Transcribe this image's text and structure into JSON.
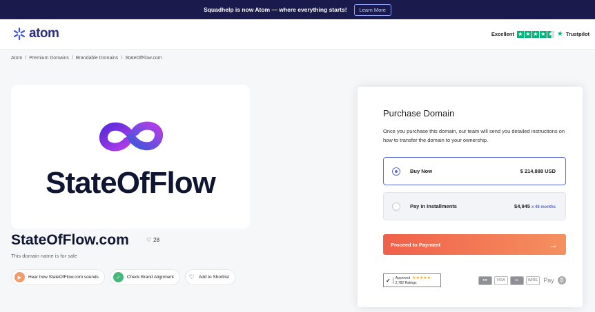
{
  "banner": {
    "text": "Squadhelp is now Atom — where everything starts!",
    "button": "Learn More"
  },
  "header": {
    "logo_text": "atom",
    "trustpilot": {
      "rating_word": "Excellent",
      "brand": "Trustpilot",
      "stars": 4.5
    }
  },
  "breadcrumb": [
    "Atom",
    "Premium Domains",
    "Brandable Domains",
    "StateOfFlow.com"
  ],
  "breadcrumb_separator": "/",
  "brand_logo": {
    "wordmark": "StateOfFlow"
  },
  "domain": {
    "name": "StateOfFlow.com",
    "likes": "28",
    "status": "This domain name is for sale"
  },
  "actions": [
    {
      "label": "Hear how StateOfFlow.com sounds",
      "icon": "play-icon"
    },
    {
      "label": "Check Brand Alignment",
      "icon": "check-icon"
    },
    {
      "label": "Add to Shortlist",
      "icon": "heart-icon"
    }
  ],
  "purchase": {
    "title": "Purchase Domain",
    "description": "Once you purchase this domain, our team will send you detailed instructions on how to transfer the domain to your ownership.",
    "options": [
      {
        "label": "Buy Now",
        "price": "$ 214,888 USD",
        "selected": true
      },
      {
        "label": "Pay in Installments",
        "price": "$4,945",
        "months": "x 48 months",
        "selected": false
      }
    ],
    "cta": "Proceed to Payment",
    "approved": {
      "badge": "Approved",
      "ratings": "2,782 Ratings"
    },
    "payment_methods": [
      "Mastercard",
      "VISA",
      "Amex",
      "Wire",
      "Apple Pay",
      "Bitcoin"
    ]
  },
  "colors": {
    "banner": "#1b1a4d",
    "accent": "#5b6ad8",
    "cta_start": "#f0604a",
    "cta_end": "#f5905f",
    "trustpilot": "#00b67a"
  }
}
